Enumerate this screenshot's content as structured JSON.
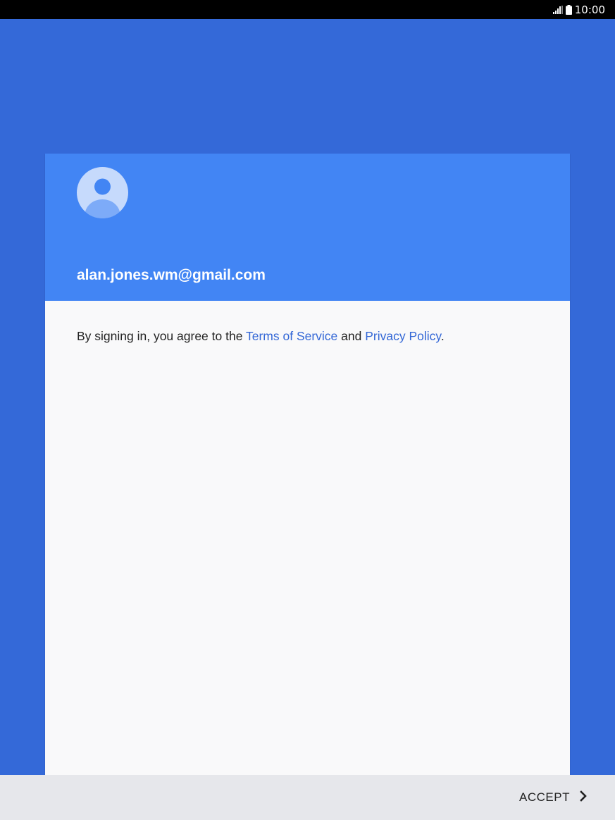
{
  "status_bar": {
    "time": "10:00",
    "icons": [
      "signal-icon",
      "battery-icon"
    ]
  },
  "account": {
    "email": "alan.jones.wm@gmail.com",
    "avatar_icon": "default-avatar-icon"
  },
  "terms": {
    "prefix": "By signing in, you agree to the ",
    "terms_link": "Terms of Service",
    "conjunction": " and ",
    "privacy_link": "Privacy Policy",
    "suffix": "."
  },
  "footer": {
    "accept_label": "ACCEPT",
    "accept_icon": "chevron-right-icon"
  },
  "colors": {
    "background": "#3469d8",
    "header": "#4285f4",
    "link": "#3367d6",
    "card": "#f9f9fa",
    "bottom_bar": "#e6e7eb"
  }
}
